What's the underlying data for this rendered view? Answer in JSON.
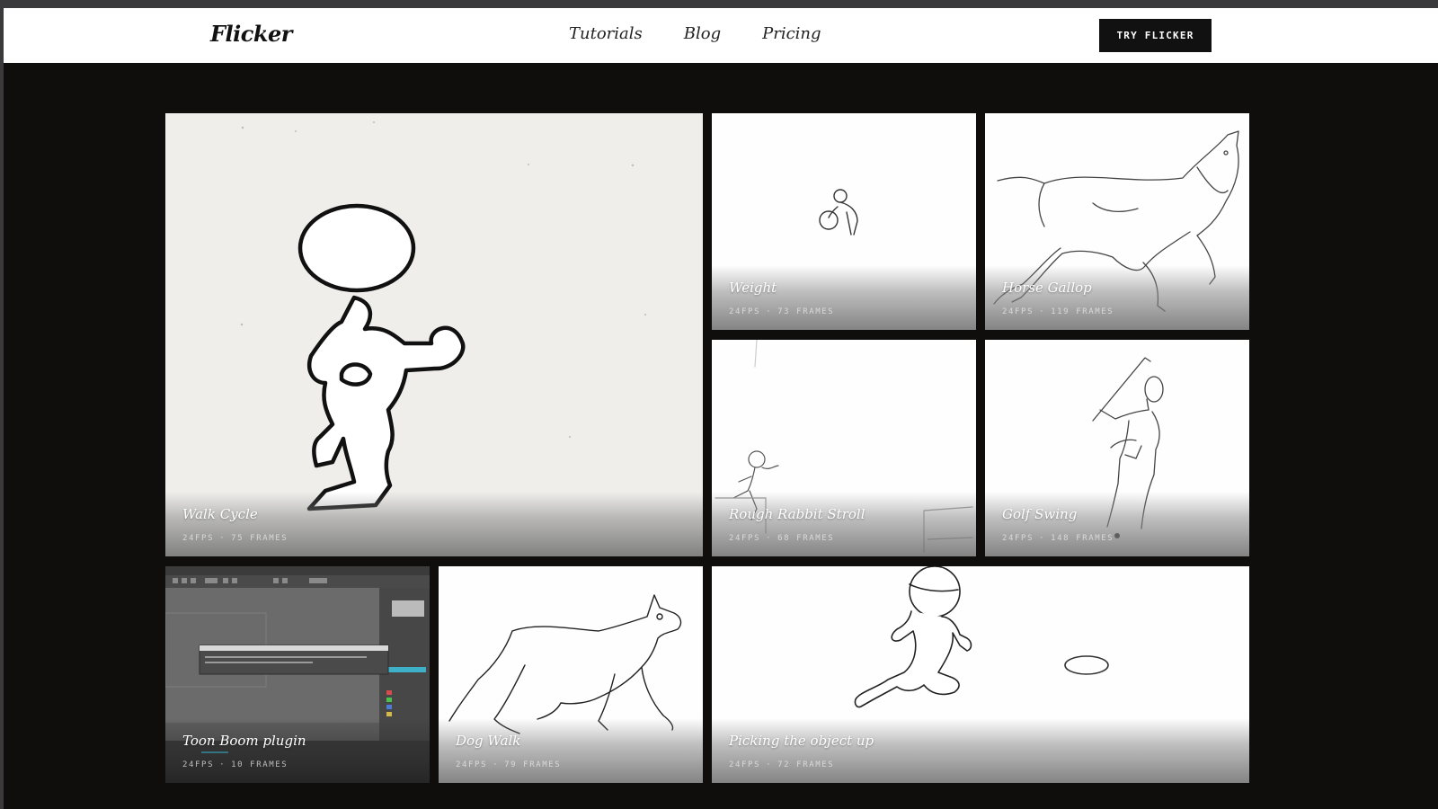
{
  "brand": "Flicker",
  "nav": {
    "links": [
      "Tutorials",
      "Blog",
      "Pricing"
    ],
    "cta": "TRY FLICKER"
  },
  "cards": [
    {
      "title": "Walk Cycle",
      "fps": "24FPS",
      "frames": "75 FRAMES"
    },
    {
      "title": "Weight",
      "fps": "24FPS",
      "frames": "73 FRAMES"
    },
    {
      "title": "Horse Gallop",
      "fps": "24FPS",
      "frames": "119 FRAMES"
    },
    {
      "title": "Rough Rabbit Stroll",
      "fps": "24FPS",
      "frames": "68 FRAMES"
    },
    {
      "title": "Golf Swing",
      "fps": "24FPS",
      "frames": "148 FRAMES"
    },
    {
      "title": "Toon Boom plugin",
      "fps": "24FPS",
      "frames": "10 FRAMES"
    },
    {
      "title": "Dog Walk",
      "fps": "24FPS",
      "frames": "79 FRAMES"
    },
    {
      "title": "Picking the object up",
      "fps": "24FPS",
      "frames": "72 FRAMES"
    }
  ]
}
